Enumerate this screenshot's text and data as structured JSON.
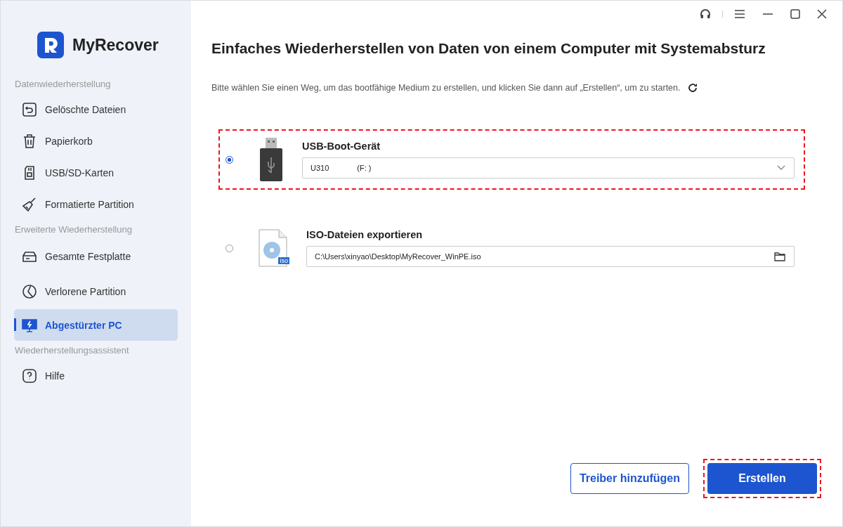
{
  "app": {
    "name": "MyRecover"
  },
  "sidebar": {
    "sections": [
      {
        "heading": "Datenwiederherstellung",
        "items": [
          {
            "label": "Gelöschte Dateien",
            "selected": false
          },
          {
            "label": "Papierkorb",
            "selected": false
          },
          {
            "label": "USB/SD-Karten",
            "selected": false
          },
          {
            "label": "Formatierte Partition",
            "selected": false
          }
        ]
      },
      {
        "heading": "Erweiterte Wiederherstellung",
        "items": [
          {
            "label": "Gesamte Festplatte",
            "selected": false
          },
          {
            "label": "Verlorene Partition",
            "selected": false
          },
          {
            "label": "Abgestürzter PC",
            "selected": true
          }
        ]
      },
      {
        "heading": "Wiederherstellungsassistent",
        "items": [
          {
            "label": "Hilfe",
            "selected": false
          }
        ]
      }
    ]
  },
  "main": {
    "title": "Einfaches Wiederherstellen von Daten von einem Computer mit Systemabsturz",
    "instruction": "Bitte wählen Sie einen Weg, um das bootfähige Medium zu erstellen, und klicken Sie dann auf „Erstellen“, um zu starten.",
    "options": [
      {
        "kind": "usb",
        "label": "USB-Boot-Gerät",
        "selected": true,
        "highlighted": true,
        "field_value": "U310",
        "field_extra": "(F: )"
      },
      {
        "kind": "iso",
        "label": "ISO-Dateien exportieren",
        "selected": false,
        "highlighted": false,
        "field_value": "C:\\Users\\xinyao\\Desktop\\MyRecover_WinPE.iso",
        "badge": "iso"
      }
    ]
  },
  "buttons": [
    {
      "label": "Treiber hinzufügen",
      "kind": "secondary",
      "highlighted": false
    },
    {
      "label": "Erstellen",
      "kind": "primary",
      "highlighted": true
    }
  ]
}
